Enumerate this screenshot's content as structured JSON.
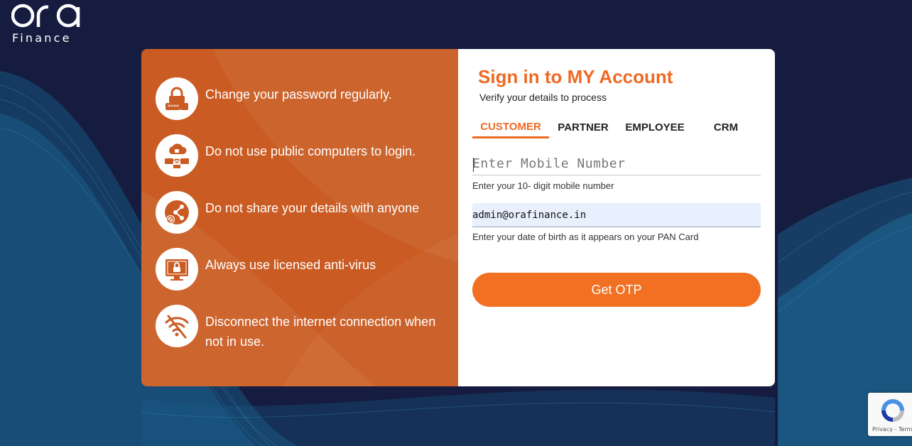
{
  "brand": {
    "logo_mark": "ora",
    "logo_subtext": "Finance"
  },
  "tips": [
    {
      "icon": "password-lock-icon",
      "text": "Change your password regularly."
    },
    {
      "icon": "public-computer-cloud-icon",
      "text": "Do not use public computers to login."
    },
    {
      "icon": "no-share-icon",
      "text": "Do not share your details with anyone"
    },
    {
      "icon": "antivirus-monitor-icon",
      "text": "Always use licensed anti-virus"
    },
    {
      "icon": "wifi-off-icon",
      "text": "Disconnect the internet connection when not in use."
    }
  ],
  "signin": {
    "title": "Sign in to MY Account",
    "subtitle": "Verify your details to process",
    "tabs": [
      "CUSTOMER",
      "PARTNER",
      "EMPLOYEE",
      "CRM"
    ],
    "active_tab": "CUSTOMER",
    "mobile": {
      "placeholder": "Enter Mobile Number",
      "value": "",
      "hint": "Enter your 10- digit mobile number"
    },
    "dob": {
      "value": "admin@orafinance.in",
      "hint": "Enter your date of birth as it appears on your PAN Card"
    },
    "submit_label": "Get OTP"
  },
  "recaptcha": {
    "terms": "Privacy - Terms"
  },
  "colors": {
    "accent": "#ee6a24",
    "button": "#f27022",
    "left_panel": "#ca5c23",
    "background": "#151c3f"
  }
}
